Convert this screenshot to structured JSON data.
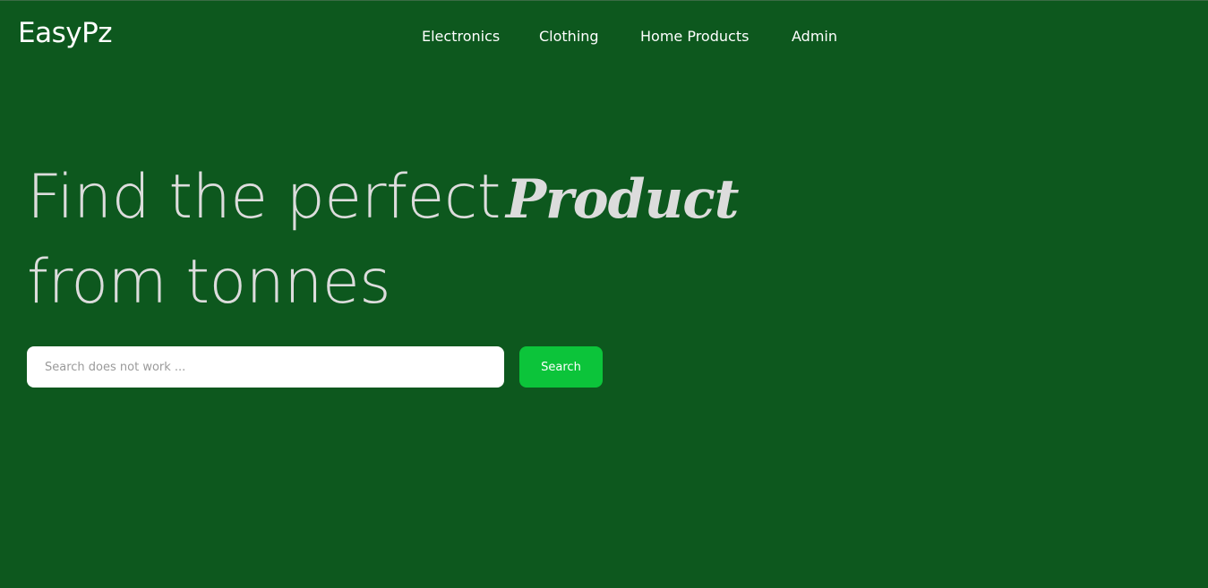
{
  "header": {
    "logo": "EasyPz",
    "nav": [
      {
        "label": "Electronics"
      },
      {
        "label": "Clothing"
      },
      {
        "label": "Home Products"
      },
      {
        "label": "Admin"
      }
    ]
  },
  "hero": {
    "line1": "Find the perfect",
    "accent": "Product",
    "line2": "from tonnes"
  },
  "search": {
    "placeholder": "Search does not work ...",
    "value": "",
    "button_label": "Search"
  },
  "colors": {
    "background": "#0d581e",
    "button": "#0cc43a",
    "hero_text": "#dcdcdc",
    "nav_text": "#ffffff"
  }
}
